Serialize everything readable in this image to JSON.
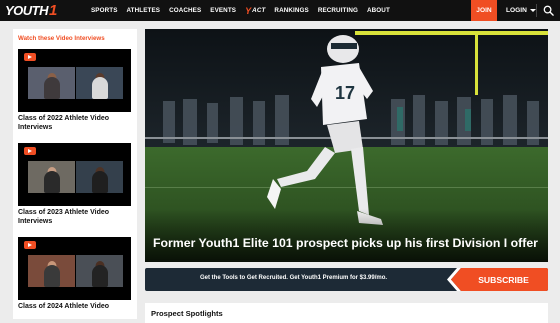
{
  "nav": {
    "logo_text": "YOUTH",
    "logo_number": "1",
    "links": [
      "SPORTS",
      "ATHLETES",
      "COACHES",
      "EVENTS"
    ],
    "act_label": "ACT",
    "links_after": [
      "RANKINGS",
      "RECRUITING",
      "ABOUT"
    ],
    "join_label": "JOIN",
    "login_label": "LOGIN",
    "search_icon": "search-icon"
  },
  "sidebar": {
    "title": "Watch these Video Interviews",
    "videos": [
      {
        "caption": "Class of 2022 Athlete Video Interviews",
        "play_icon": "play-icon"
      },
      {
        "caption": "Class of 2023 Athlete Video Interviews",
        "play_icon": "play-icon"
      },
      {
        "caption": "Class of 2024 Athlete Video",
        "play_icon": "play-icon"
      }
    ]
  },
  "hero": {
    "headline": "Former Youth1 Elite 101 prospect picks up his first Division I offer",
    "jersey_number": "17"
  },
  "promo": {
    "text": "Get the Tools to Get Recruited. Get Youth1 Premium for $3.99/mo.",
    "cta": "SUBSCRIBE"
  },
  "spotlight": {
    "title": "Prospect Spotlights"
  },
  "colors": {
    "accent": "#f04e23",
    "nav_bg": "#111111",
    "promo_bg": "#1d2a36"
  }
}
